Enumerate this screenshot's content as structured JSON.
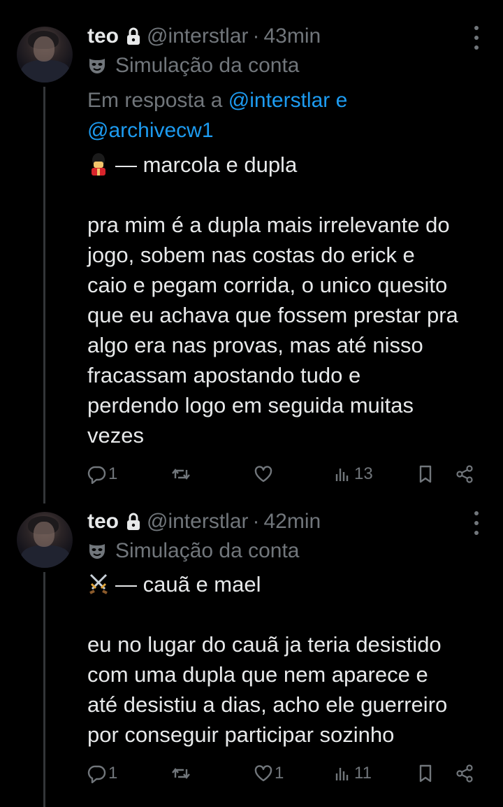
{
  "tweets": [
    {
      "name": "teo",
      "handle": "@interstlar",
      "dot": "·",
      "time": "43min",
      "simulation_label": "Simulação da conta",
      "reply_prefix": "Em resposta a",
      "reply_mention_1": "@interstlar",
      "reply_and": "e",
      "reply_mention_2": "@archivecw1",
      "emoji_icon": "guard-emoji",
      "title_line": "— marcola e dupla",
      "body_lines": [
        "pra mim é a dupla mais irrelevante do",
        "jogo, sobem nas costas do erick e",
        "caio e pegam corrida, o unico quesito",
        "que eu achava que fossem prestar pra",
        "algo era nas provas, mas até nisso",
        "fracassam apostando tudo e",
        "perdendo logo em seguida muitas",
        "vezes"
      ],
      "actions": {
        "replies": "1",
        "retweets": "",
        "likes": "",
        "views": "13"
      }
    },
    {
      "name": "teo",
      "handle": "@interstlar",
      "dot": "·",
      "time": "42min",
      "simulation_label": "Simulação da conta",
      "emoji_icon": "crossed-swords-emoji",
      "title_line": "— cauã e mael",
      "body_lines": [
        "eu no lugar do cauã ja teria desistido",
        "com uma dupla que nem aparece e",
        "até desistiu a dias, acho ele guerreiro",
        "por conseguir participar sozinho"
      ],
      "actions": {
        "replies": "1",
        "retweets": "",
        "likes": "1",
        "views": "11"
      }
    }
  ],
  "colors": {
    "background": "#000000",
    "text": "#e7e9ea",
    "muted": "#71767b",
    "link": "#1d9bf0",
    "thread_line": "#333639"
  }
}
